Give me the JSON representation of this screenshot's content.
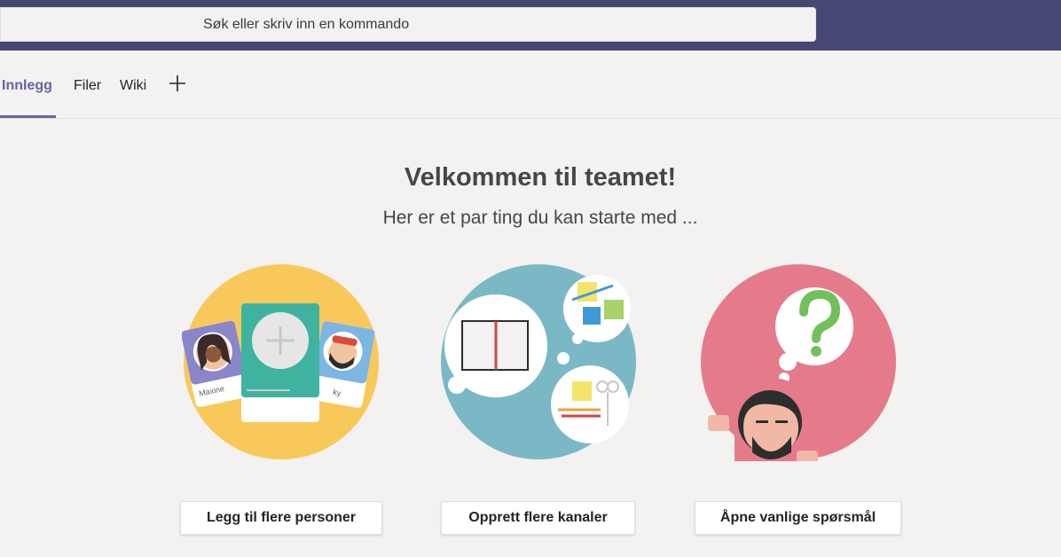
{
  "search": {
    "placeholder": "Søk eller skriv inn en kommando"
  },
  "tabs": [
    {
      "label": "Innlegg",
      "active": true
    },
    {
      "label": "Filer",
      "active": false
    },
    {
      "label": "Wiki",
      "active": false
    }
  ],
  "add_tab_icon": "plus-icon",
  "welcome": {
    "title": "Velkommen til teamet!",
    "subtitle": "Her er et par ting du kan starte med ..."
  },
  "cards": [
    {
      "illustration": "people-cards-illustration",
      "button_label": "Legg til flere personer",
      "person_labels": [
        "Maxine",
        "ky"
      ]
    },
    {
      "illustration": "channels-illustration",
      "button_label": "Opprett flere kanaler"
    },
    {
      "illustration": "faq-illustration",
      "button_label": "Åpne vanlige spørsmål"
    }
  ],
  "colors": {
    "topbar": "#464775",
    "accent": "#6264a7",
    "background": "#f3f2f1",
    "circle_yellow": "#f8c95a",
    "circle_teal": "#7bb8c6",
    "circle_pink": "#e57b8a"
  }
}
